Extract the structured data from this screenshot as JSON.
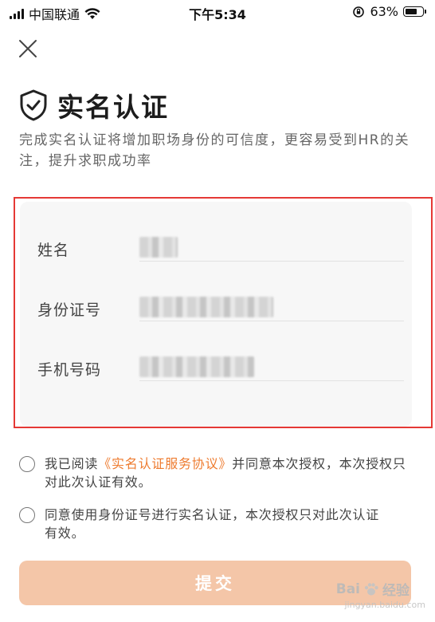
{
  "status_bar": {
    "carrier": "中国联通",
    "time": "下午5:34",
    "battery": "63%"
  },
  "header": {
    "close_icon": "close-icon",
    "title": "实名认证",
    "title_icon": "shield-check-icon",
    "subtitle": "完成实名认证将增加职场身份的可信度，更容易受到HR的关注，提升求职成功率"
  },
  "form": {
    "fields": [
      {
        "label": "姓名",
        "value": ""
      },
      {
        "label": "身份证号",
        "value": ""
      },
      {
        "label": "手机号码",
        "value": ""
      }
    ]
  },
  "agreements": [
    {
      "before": "我已阅读",
      "link": "《实名认证服务协议》",
      "after": "并同意本次授权，本次授权只对此次认证有效。"
    },
    {
      "before": "同意使用身份证号进行实名认证，本次授权只对此次认证有效。",
      "link": "",
      "after": ""
    }
  ],
  "submit_label": "提交",
  "watermark": {
    "brand": "Bai",
    "brand2": "经验",
    "sub": "jingyan.baidu.com"
  },
  "colors": {
    "accent": "#ee7b2f",
    "button_disabled": "#f4c6a8",
    "highlight_frame": "#e53935"
  }
}
